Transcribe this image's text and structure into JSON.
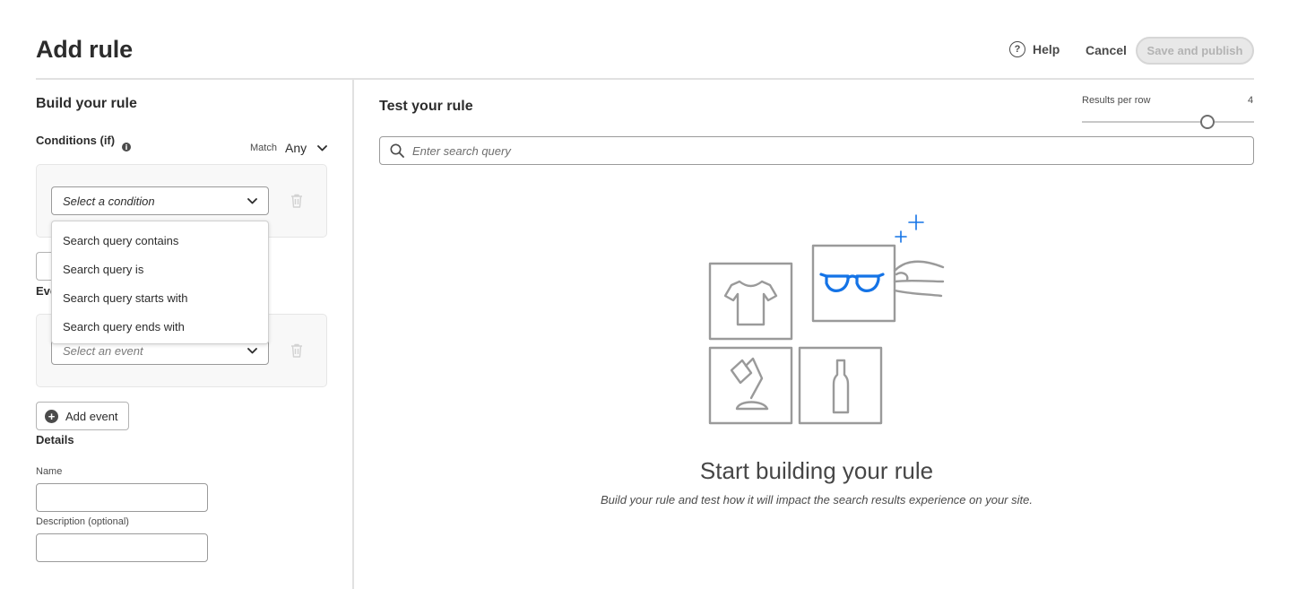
{
  "header": {
    "title": "Add rule",
    "help_label": "Help",
    "cancel_label": "Cancel",
    "save_label": "Save and publish"
  },
  "build": {
    "title": "Build your rule",
    "conditions_label": "Conditions (if)",
    "match_label": "Match",
    "match_value": "Any",
    "condition_select_placeholder": "Select a condition",
    "condition_options": [
      "Search query contains",
      "Search query is",
      "Search query starts with",
      "Search query ends with"
    ],
    "events_label": "Events (then)",
    "event_select_placeholder": "Select an event",
    "add_event_label": "Add event"
  },
  "details": {
    "title": "Details",
    "name_label": "Name",
    "description_label": "Description (optional)"
  },
  "test": {
    "title": "Test your rule",
    "results_per_row_label": "Results per row",
    "results_per_row_value": "4",
    "results_per_row_level": 4,
    "search_placeholder": "Enter search query",
    "empty_title": "Start building your rule",
    "empty_subtitle": "Build your rule and test how it will impact the search results experience on your site."
  },
  "colors": {
    "accent_blue": "#1473e6",
    "illustration_gray": "#9a9a9a",
    "disabled_button": "#e8e8e8"
  },
  "icons": {
    "help": "help-circle-icon",
    "info": "info-icon",
    "chevron": "chevron-down-icon",
    "delete": "trash-icon",
    "add": "add-circle-icon",
    "search": "search-icon"
  }
}
